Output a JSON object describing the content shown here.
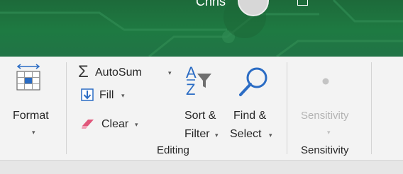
{
  "titlebar": {
    "user_name": "Chris",
    "icons": [
      "avatar-icon",
      "restore-window-icon"
    ],
    "colors": {
      "background": "#217346",
      "text": "#ffffff"
    }
  },
  "ribbon": {
    "format": {
      "label": "Format",
      "icon": "format-cells-icon"
    },
    "editing": {
      "group_label": "Editing",
      "autosum": {
        "label": "AutoSum",
        "icon": "sigma-icon"
      },
      "fill": {
        "label": "Fill",
        "icon": "fill-down-icon"
      },
      "clear": {
        "label": "Clear",
        "icon": "eraser-icon"
      },
      "sort_filter": {
        "line1": "Sort &",
        "line2": "Filter",
        "icon": "sort-filter-icon"
      },
      "find_select": {
        "line1": "Find &",
        "line2": "Select",
        "icon": "magnifier-icon"
      }
    },
    "sensitivity": {
      "group_label": "Sensitivity",
      "button": {
        "label": "Sensitivity",
        "icon": "sensitivity-icon",
        "enabled": false
      }
    },
    "colors": {
      "background": "#f3f3f3",
      "accent_blue": "#2b6cc4",
      "eraser_pink": "#e0567a"
    }
  }
}
